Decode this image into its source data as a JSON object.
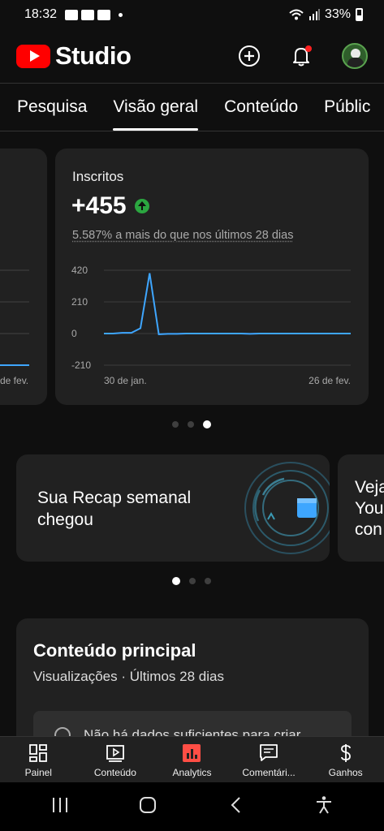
{
  "status_bar": {
    "time": "18:32",
    "battery": "33%"
  },
  "header": {
    "logo_text": "Studio",
    "brand_color": "#ff0000",
    "icons": [
      "add-icon",
      "bell-icon",
      "avatar"
    ]
  },
  "tabs": [
    {
      "label": "Pesquisa",
      "active": false
    },
    {
      "label": "Visão geral",
      "active": true
    },
    {
      "label": "Conteúdo",
      "active": false
    },
    {
      "label": "Públic",
      "active": false
    }
  ],
  "left_card": {
    "date_label": "de fev."
  },
  "subscribers_card": {
    "title": "Inscritos",
    "value": "+455",
    "delta": "5.587% a mais do que nos últimos 28 dias",
    "accent": "#3ea6ff",
    "up_color": "#2ba640"
  },
  "chart_data": {
    "type": "line",
    "title": "Inscritos",
    "y_ticks": [
      "420",
      "210",
      "0",
      "-210"
    ],
    "ylim": [
      -210,
      420
    ],
    "x_labels": [
      "30 de jan.",
      "26 de fev."
    ],
    "series": [
      {
        "values": [
          0,
          0,
          5,
          5,
          35,
          400,
          -5,
          -2,
          -2,
          0,
          0,
          0,
          0,
          0,
          0,
          0,
          -2,
          0,
          0,
          0,
          0,
          0,
          0,
          0,
          0,
          0,
          0,
          0
        ]
      }
    ]
  },
  "carousel1": {
    "count": 3,
    "active": 2
  },
  "recap_card": {
    "text": "Sua Recap semanal chegou"
  },
  "next_card": {
    "lines": [
      "Veja",
      "You",
      "con"
    ]
  },
  "carousel2": {
    "count": 3,
    "active": 0
  },
  "top_content": {
    "title": "Conteúdo principal",
    "subtitle": "Visualizações · Últimos 28 dias",
    "empty_text": "Não há dados suficientes para criar"
  },
  "bottom_nav": [
    {
      "label": "Painel",
      "icon": "dashboard-icon",
      "active": false
    },
    {
      "label": "Conteúdo",
      "icon": "content-icon",
      "active": false
    },
    {
      "label": "Analytics",
      "icon": "analytics-icon",
      "active": true
    },
    {
      "label": "Comentári...",
      "icon": "comments-icon",
      "active": false
    },
    {
      "label": "Ganhos",
      "icon": "dollar-icon",
      "active": false
    }
  ]
}
